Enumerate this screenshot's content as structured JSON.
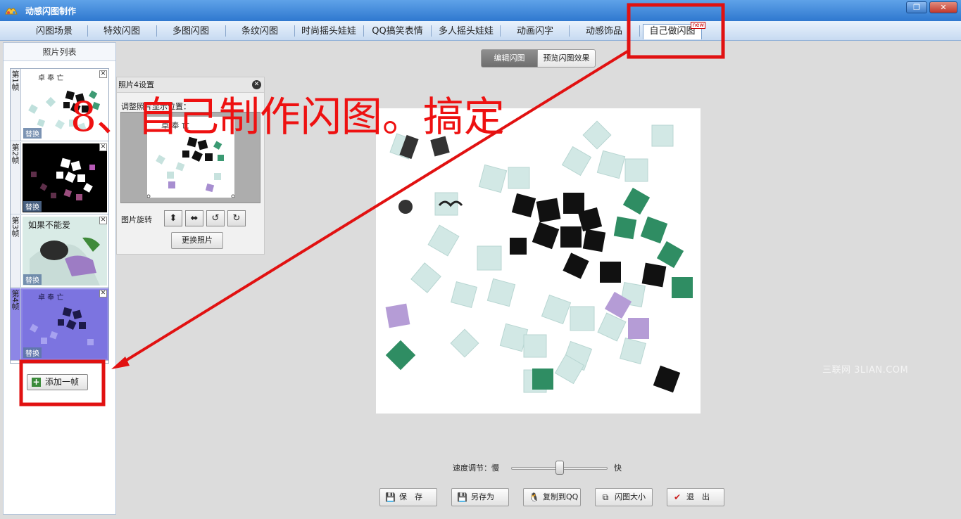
{
  "app": {
    "title": "动感闪图制作",
    "restore_icon": "restore-icon",
    "close_icon": "close-icon"
  },
  "tabs": [
    {
      "label": "闪图场景"
    },
    {
      "label": "特效闪图"
    },
    {
      "label": "多图闪图"
    },
    {
      "label": "条纹闪图"
    },
    {
      "label": "时尚摇头娃娃"
    },
    {
      "label": "QQ搞笑表情"
    },
    {
      "label": "多人摇头娃娃"
    },
    {
      "label": "动画闪字"
    },
    {
      "label": "动感饰品"
    },
    {
      "label": "自己做闪图",
      "badge": "new"
    }
  ],
  "left_panel": {
    "title": "照片列表",
    "frames": [
      {
        "label": "第1帧",
        "replace": "替换"
      },
      {
        "label": "第2帧",
        "replace": "替换"
      },
      {
        "label": "第3帧",
        "replace": "替换"
      },
      {
        "label": "第4帧",
        "replace": "替换"
      }
    ],
    "add_frame": "添加一帧"
  },
  "settings": {
    "title": "照片4设置",
    "adjust_label": "调整照片显示位置：",
    "rotate_label": "图片旋转",
    "change_photo": "更换照片"
  },
  "mode": {
    "edit": "编辑闪图",
    "preview": "预览闪图效果"
  },
  "speed": {
    "label": "速度调节：慢",
    "fast": "快",
    "value": 0.5
  },
  "actions": [
    {
      "label": "保　存",
      "icon": "save-icon"
    },
    {
      "label": "另存为",
      "icon": "save-as-icon"
    },
    {
      "label": "复制到QQ",
      "icon": "qq-icon"
    },
    {
      "label": "闪图大小",
      "icon": "resize-icon"
    },
    {
      "label": "退　出",
      "icon": "exit-icon"
    }
  ],
  "annotation": {
    "text": "8、自己制作闪图。搞定",
    "color": "#e11111"
  },
  "watermark": "三联网 3LIAN.COM"
}
